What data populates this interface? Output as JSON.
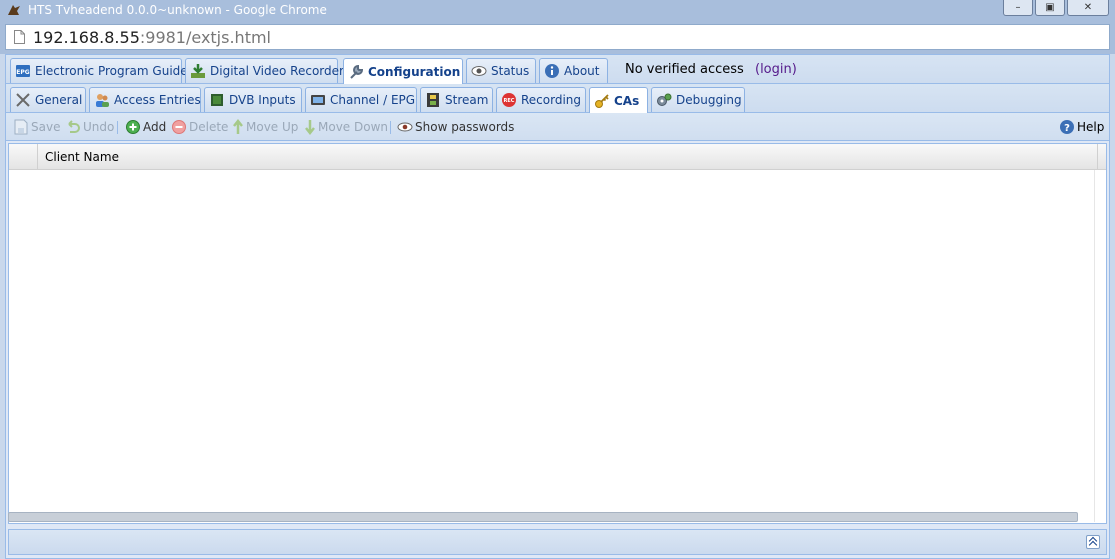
{
  "window": {
    "title": "HTS Tvheadend 0.0.0~unknown - Google Chrome"
  },
  "address": {
    "host": "192.168.8.55",
    "port_path": ":9981/extjs.html"
  },
  "main_tabs": [
    {
      "label": "Electronic Program Guide",
      "icon": "epg-icon"
    },
    {
      "label": "Digital Video Recorder",
      "icon": "download-icon"
    },
    {
      "label": "Configuration",
      "icon": "wrench-icon",
      "active": true
    },
    {
      "label": "Status",
      "icon": "eye-icon"
    },
    {
      "label": "About",
      "icon": "info-icon"
    }
  ],
  "access": {
    "status": "No verified access",
    "login": "(login)"
  },
  "sub_tabs": [
    {
      "label": "General",
      "icon": "tools-icon"
    },
    {
      "label": "Access Entries",
      "icon": "users-icon"
    },
    {
      "label": "DVB Inputs",
      "icon": "chip-icon"
    },
    {
      "label": "Channel / EPG",
      "icon": "tv-icon"
    },
    {
      "label": "Stream",
      "icon": "film-icon"
    },
    {
      "label": "Recording",
      "icon": "rec-icon"
    },
    {
      "label": "CAs",
      "icon": "key-icon",
      "active": true
    },
    {
      "label": "Debugging",
      "icon": "gears-icon"
    }
  ],
  "toolbar": {
    "save": "Save",
    "undo": "Undo",
    "add": "Add",
    "delete": "Delete",
    "move_up": "Move Up",
    "move_down": "Move Down",
    "show_passwords": "Show passwords",
    "help": "Help"
  },
  "grid": {
    "columns": [
      "Client Name"
    ],
    "rows": []
  },
  "colors": {
    "accent": "#15428b",
    "border": "#99bbe8",
    "panel": "#dfe8f6"
  }
}
